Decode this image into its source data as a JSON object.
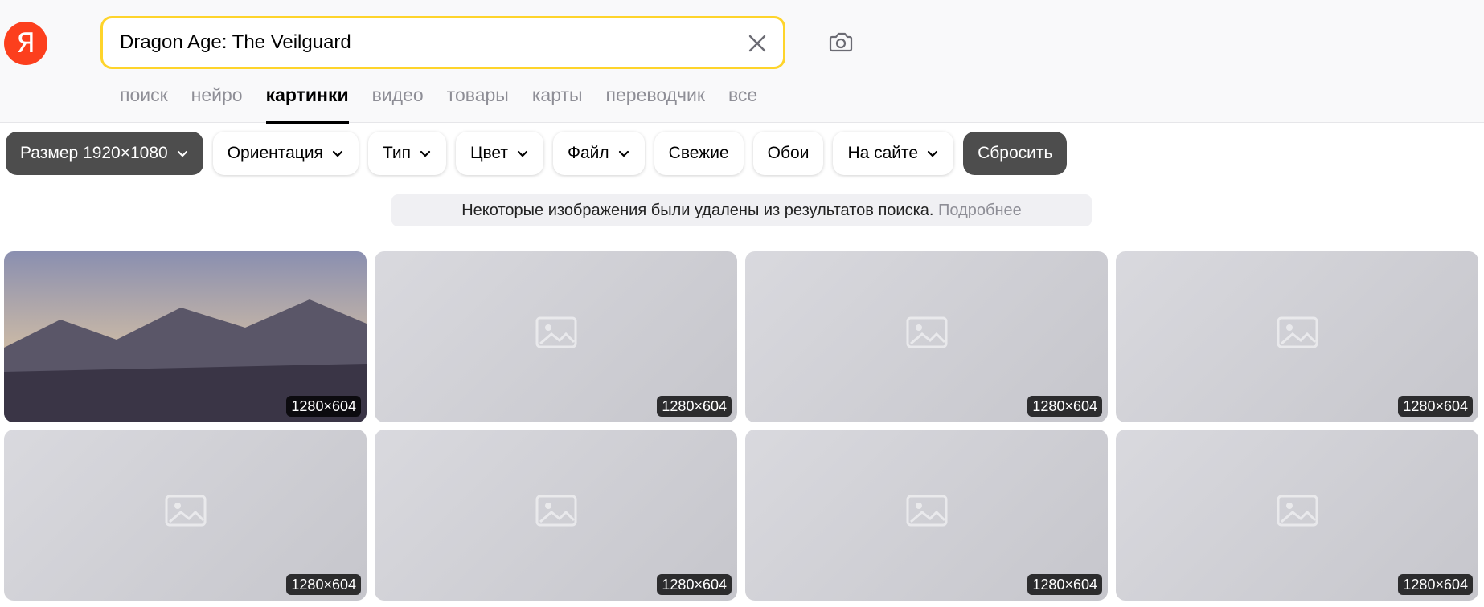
{
  "logo": {
    "glyph": "Я"
  },
  "search": {
    "value": "Dragon Age: The Veilguard",
    "clear_icon": "close-icon",
    "camera_icon": "camera-icon"
  },
  "tabs": [
    {
      "label": "поиск",
      "active": false
    },
    {
      "label": "нейро",
      "active": false
    },
    {
      "label": "картинки",
      "active": true
    },
    {
      "label": "видео",
      "active": false
    },
    {
      "label": "товары",
      "active": false
    },
    {
      "label": "карты",
      "active": false
    },
    {
      "label": "переводчик",
      "active": false
    },
    {
      "label": "все",
      "active": false
    }
  ],
  "filters": {
    "size": "Размер 1920×1080",
    "orientation": "Ориентация",
    "type": "Тип",
    "color": "Цвет",
    "file": "Файл",
    "fresh": "Свежие",
    "wallpapers": "Обои",
    "on_site": "На сайте",
    "reset": "Сбросить"
  },
  "notice": {
    "text": "Некоторые изображения были удалены из результатов поиска.",
    "link": "Подробнее"
  },
  "results": [
    {
      "dimensions": "1280×604"
    },
    {
      "dimensions": "1280×604"
    },
    {
      "dimensions": "1280×604"
    },
    {
      "dimensions": "1280×604"
    },
    {
      "dimensions": "1280×604"
    },
    {
      "dimensions": "1280×604"
    },
    {
      "dimensions": "1280×604"
    },
    {
      "dimensions": "1280×604"
    }
  ],
  "colors": {
    "logo_red": "#fc3f1d",
    "search_border": "#fed42b",
    "active_chip": "#4d4d4d"
  }
}
